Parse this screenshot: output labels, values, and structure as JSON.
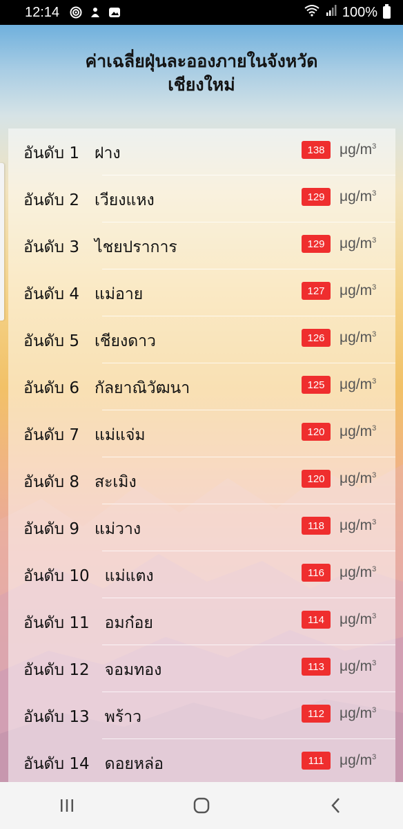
{
  "status_bar": {
    "time": "12:14",
    "battery": "100%",
    "notification_icons": [
      "target-icon",
      "app-icon",
      "photo-icon"
    ]
  },
  "header": {
    "title_line1": "ค่าเฉลี่ยฝุ่นละอองภายในจังหวัด",
    "title_line2": "เชียงใหม่"
  },
  "unit": "μg/m",
  "unit_superscript": "3",
  "colors": {
    "badge": "#ef2e2e",
    "nav_background": "#f4f4f4"
  },
  "rankings": [
    {
      "label": "อันดับ 1",
      "district": "ฝาง",
      "value": "138"
    },
    {
      "label": "อันดับ 2",
      "district": "เวียงแหง",
      "value": "129"
    },
    {
      "label": "อันดับ 3",
      "district": "ไชยปราการ",
      "value": "129"
    },
    {
      "label": "อันดับ 4",
      "district": "แม่อาย",
      "value": "127"
    },
    {
      "label": "อันดับ 5",
      "district": "เชียงดาว",
      "value": "126"
    },
    {
      "label": "อันดับ 6",
      "district": "กัลยาณิวัฒนา",
      "value": "125"
    },
    {
      "label": "อันดับ 7",
      "district": "แม่แจ่ม",
      "value": "120"
    },
    {
      "label": "อันดับ 8",
      "district": "สะเมิง",
      "value": "120"
    },
    {
      "label": "อันดับ 9",
      "district": "แม่วาง",
      "value": "118"
    },
    {
      "label": "อันดับ 10",
      "district": "แม่แตง",
      "value": "116"
    },
    {
      "label": "อันดับ 11",
      "district": "อมก๋อย",
      "value": "114"
    },
    {
      "label": "อันดับ 12",
      "district": "จอมทอง",
      "value": "113"
    },
    {
      "label": "อันดับ 13",
      "district": "พร้าว",
      "value": "112"
    },
    {
      "label": "อันดับ 14",
      "district": "ดอยหล่อ",
      "value": "111"
    }
  ],
  "nav": {
    "recent": "recent-apps-icon",
    "home": "home-icon",
    "back": "back-icon"
  }
}
